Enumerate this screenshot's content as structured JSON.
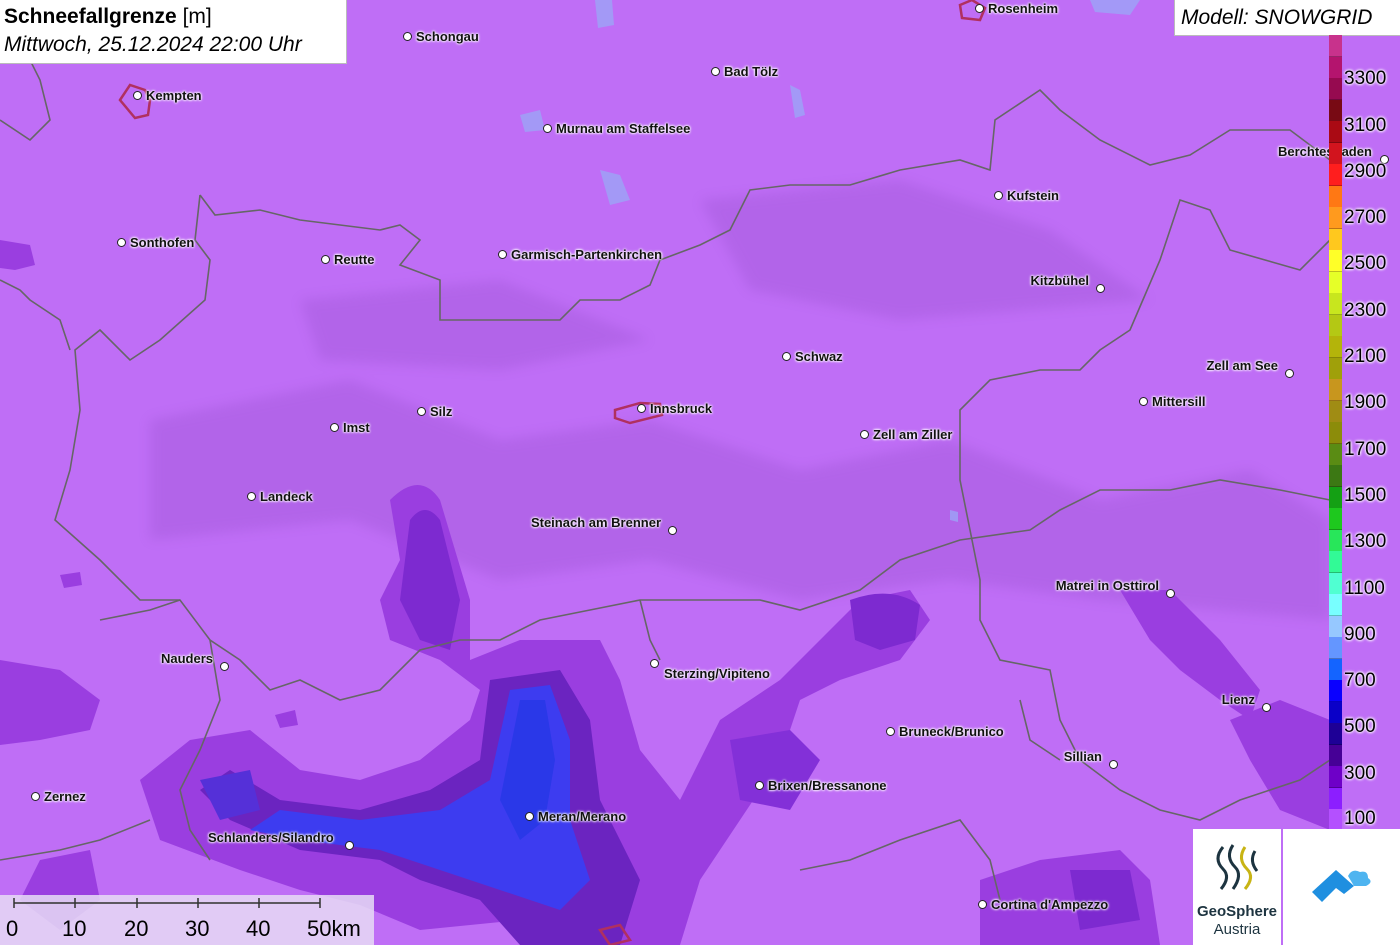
{
  "header": {
    "title_bold": "Schneefallgrenze",
    "title_unit": "[m]",
    "datetime": "Mittwoch, 25.12.2024 22:00 Uhr"
  },
  "model": {
    "label": "Modell: SNOWGRID"
  },
  "places": [
    {
      "name": "Rosenheim"
    },
    {
      "name": "Schongau"
    },
    {
      "name": "Bad Tölz"
    },
    {
      "name": "Kempten"
    },
    {
      "name": "Murnau am Staffelsee"
    },
    {
      "name": "Berchtesgaden"
    },
    {
      "name": "Kufstein"
    },
    {
      "name": "Sonthofen"
    },
    {
      "name": "Reutte"
    },
    {
      "name": "Garmisch-Partenkirchen"
    },
    {
      "name": "Kitzbühel"
    },
    {
      "name": "Schwaz"
    },
    {
      "name": "Zell am See"
    },
    {
      "name": "Mittersill"
    },
    {
      "name": "Imst"
    },
    {
      "name": "Silz"
    },
    {
      "name": "Innsbruck"
    },
    {
      "name": "Zell am Ziller"
    },
    {
      "name": "Landeck"
    },
    {
      "name": "Steinach am Brenner"
    },
    {
      "name": "Matrei in Osttirol"
    },
    {
      "name": "Nauders"
    },
    {
      "name": "Sterzing/Vipiteno"
    },
    {
      "name": "Lienz"
    },
    {
      "name": "Bruneck/Brunico"
    },
    {
      "name": "Sillian"
    },
    {
      "name": "Brixen/Bressanone"
    },
    {
      "name": "Zernez"
    },
    {
      "name": "Meran/Merano"
    },
    {
      "name": "Schlanders/Silandro"
    },
    {
      "name": "Cortina d'Ampezzo"
    }
  ],
  "legend": {
    "unit": "m",
    "labels": [
      "3300",
      "3100",
      "2900",
      "2700",
      "2500",
      "2300",
      "2100",
      "1900",
      "1700",
      "1500",
      "1300",
      "1100",
      "900",
      "700",
      "500",
      "300",
      "100"
    ],
    "colors": [
      "#c8328c",
      "#b4146e",
      "#960a50",
      "#780a14",
      "#aa0a14",
      "#d2141e",
      "#ff1e1e",
      "#ff7814",
      "#ff9a1e",
      "#ffc81e",
      "#ffff28",
      "#e6ff28",
      "#c8e61e",
      "#b4c814",
      "#b4b40a",
      "#a0a00a",
      "#c8961e",
      "#a08c14",
      "#8c8c0a",
      "#5a8c14",
      "#3c7814",
      "#14a014",
      "#1ec81e",
      "#28e65a",
      "#32fa96",
      "#50ffd2",
      "#78ffff",
      "#96c8ff",
      "#6496ff",
      "#1464ff",
      "#0a00ff",
      "#0a00c8",
      "#1e0096",
      "#460096",
      "#6e00c8",
      "#8c1eff",
      "#b450ff"
    ]
  },
  "scale": {
    "labels": [
      "0",
      "10",
      "20",
      "30",
      "40",
      "50km"
    ]
  },
  "logos": {
    "geosphere_line1": "GeoSphere",
    "geosphere_line2": "Austria"
  }
}
